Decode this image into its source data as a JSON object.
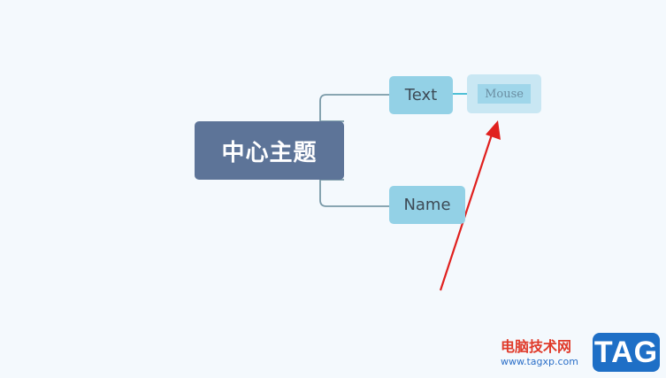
{
  "mindmap": {
    "central_topic": "中心主题",
    "subtopics": [
      {
        "label": "Text"
      },
      {
        "label": "Name"
      }
    ],
    "new_topic_input": {
      "value": "Mouse"
    }
  },
  "watermark": {
    "site_name": "电脑技术网",
    "url": "www.tagxp.com",
    "logo_text": "TAG"
  },
  "colors": {
    "background": "#f4f9fd",
    "central_fill": "#5d7498",
    "subtopic_fill": "#93d1e6",
    "new_topic_fill": "#c9e7f3",
    "connector": "#7a9aa8",
    "arrow": "#e0201e"
  }
}
